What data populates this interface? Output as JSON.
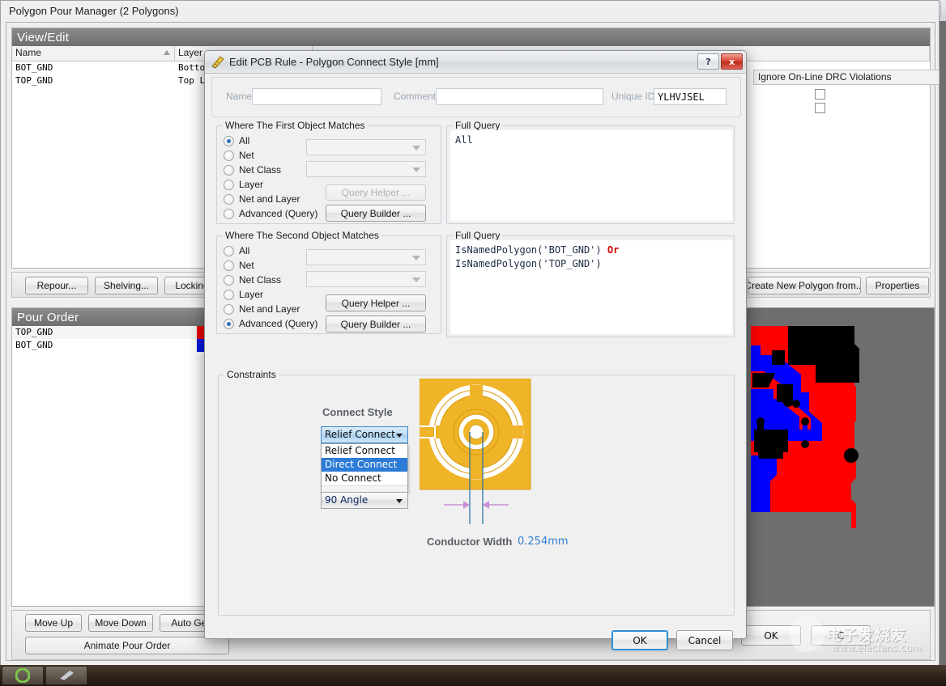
{
  "window": {
    "title": "Polygon Pour Manager (2 Polygons)",
    "help_icon": "?",
    "close_icon": "X"
  },
  "viewedit": {
    "header": "View/Edit",
    "columns": [
      "Name",
      "Layer"
    ],
    "rows": [
      {
        "name": "BOT_GND",
        "layer": "Bottom L..."
      },
      {
        "name": "TOP_GND",
        "layer": "Top Laye"
      }
    ],
    "buttons": [
      "Repour...",
      "Shelving...",
      "Locking...",
      "Create New Polygon from...",
      "Properties"
    ]
  },
  "ignore_panel": {
    "header": "Ignore On-Line DRC Violations",
    "checkbox_count": 2
  },
  "pour_order": {
    "header": "Pour Order",
    "rows": [
      {
        "name": "TOP_GND",
        "color": "#ee0000"
      },
      {
        "name": "BOT_GND",
        "color": "#0018e0"
      }
    ],
    "buttons": [
      "Move Up",
      "Move Down",
      "Auto Gene",
      "Animate Pour Order"
    ]
  },
  "window_footer": {
    "ok": "OK",
    "cancel": "C"
  },
  "dialog": {
    "title": "Edit PCB Rule - Polygon Connect Style [mm]",
    "titlebar_icon": "pcb-rule-icon",
    "help_icon": "?",
    "close_icon": "x",
    "header": {
      "name_label": "Name",
      "name_value": "",
      "comment_label": "Comment",
      "comment_value": "",
      "unique_id_label": "Unique ID",
      "unique_id_value": "YLHVJSEL"
    },
    "first_object": {
      "group_title": "Where The First Object Matches",
      "options": [
        "All",
        "Net",
        "Net Class",
        "Layer",
        "Net and Layer",
        "Advanced (Query)"
      ],
      "selected": "All",
      "net_value": "",
      "net_class_value": "",
      "query_helper": "Query Helper ...",
      "query_builder": "Query Builder ...",
      "full_query_title": "Full Query",
      "full_query": "All"
    },
    "second_object": {
      "group_title": "Where The Second Object Matches",
      "options": [
        "All",
        "Net",
        "Net Class",
        "Layer",
        "Net and Layer",
        "Advanced (Query)"
      ],
      "selected": "Advanced (Query)",
      "net_value": "",
      "net_class_value": "",
      "query_helper": "Query Helper ...",
      "query_builder": "Query Builder ...",
      "full_query_title": "Full Query",
      "full_query_line1_a": "IsNamedPolygon('BOT_GND')",
      "full_query_line1_op": "Or",
      "full_query_line2": "IsNamedPolygon('TOP_GND')"
    },
    "constraints": {
      "group_title": "Constraints",
      "connect_style_label": "Connect Style",
      "connect_style_value": "Relief Connect",
      "connect_style_options": [
        "Relief Connect",
        "Direct Connect",
        "No Connect"
      ],
      "connect_style_highlighted": "Direct Connect",
      "angle_value": "90 Angle",
      "conductor_width_label": "Conductor Width",
      "conductor_width_value": "0.254mm",
      "preview_icon": "thermal-relief-pad-preview",
      "pad_color": "#f0b429",
      "value_color": "#2f7fd0"
    },
    "footer": {
      "ok": "OK",
      "cancel": "Cancel"
    }
  },
  "watermark": {
    "text": "电子发烧友",
    "url": "www.elecfans.com"
  }
}
